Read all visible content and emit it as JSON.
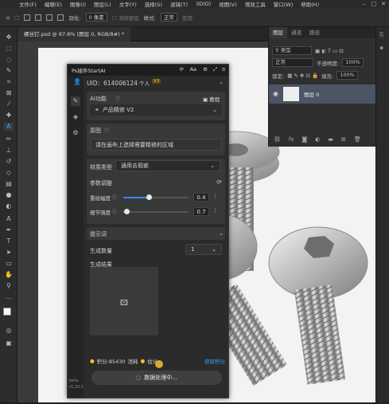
{
  "menu": [
    "文件(F)",
    "编辑(E)",
    "图像(I)",
    "图层(L)",
    "文字(Y)",
    "选择(S)",
    "滤镜(T)",
    "3D(D)",
    "视图(V)",
    "增效工具",
    "窗口(W)",
    "帮助(H)"
  ],
  "options": {
    "feather_label": "羽化:",
    "feather_value": "0 像素",
    "antialias": "消除锯齿",
    "style_label": "样式:",
    "style_value": "正常",
    "width_label": "宽度:"
  },
  "doc_tab": "螺丝钉.psd @ 87.8% (图层 0, RGB/8#) *",
  "layers_panel": {
    "tabs": [
      "图层",
      "通道",
      "路径"
    ],
    "kind": "类型",
    "blend_mode": "正常",
    "opacity_label": "不透明度:",
    "opacity_value": "100%",
    "lock_label": "锁定:",
    "fill_label": "填充:",
    "fill_value": "100%",
    "layer_name": "图层 0",
    "footer_icons": "fx"
  },
  "plugin": {
    "title": "Ps插件StartAI",
    "uid_label": "UID：614006124",
    "badge_personal": "个人",
    "badge_vip": "V3",
    "ai_func_label": "AI功能",
    "tutorial": "教程",
    "func_value": "产品精修 V2",
    "original_label": "原图",
    "original_hint": "请在画布上选择需要精修的区域",
    "material_label": "材质类型",
    "material_value": "通用去瑕疵",
    "params_label": "参数调整",
    "redraw_label": "重绘幅度",
    "redraw_value": "0.4",
    "redraw_fraction": 0.4,
    "detail_label": "细节强度",
    "detail_value": "0.7",
    "detail_fraction": 0.05,
    "prompt_label": "提示词",
    "count_label": "生成数量",
    "count_value": "1",
    "result_label": "生成结果",
    "points_label": "积分:85430",
    "consume_label": "消耗",
    "estimate_label": "估计",
    "get_points": "获取积分",
    "generate_status": "数据处理中...",
    "version_beta": "beta",
    "version": "v5.20.3"
  },
  "colors": {
    "accent": "#2f8cff",
    "gold": "#f5c131",
    "ps_blue": "#31a8ff"
  }
}
